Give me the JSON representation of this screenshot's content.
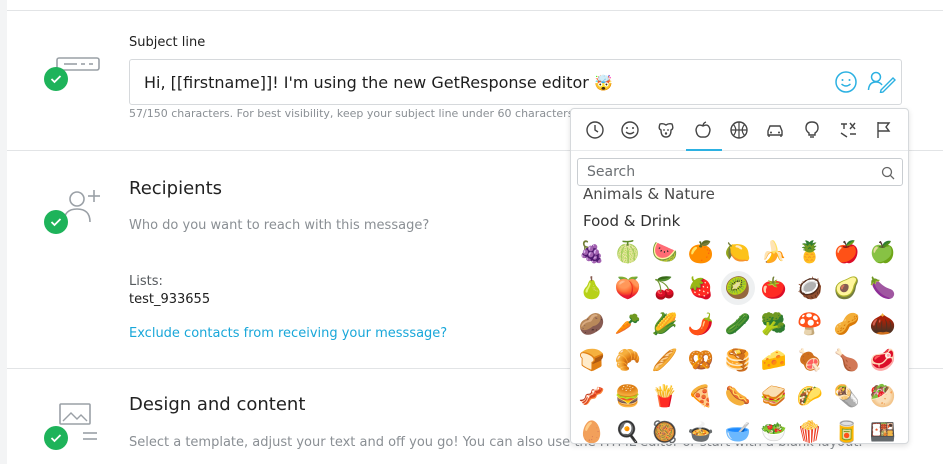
{
  "subject": {
    "label": "Subject line",
    "value": "Hi, [[firstname]]! I'm using the new GetResponse editor",
    "value_emoji": "🤯",
    "hint": "57/150 characters. For best visibility, keep your subject line under 60 characters"
  },
  "recipients": {
    "title": "Recipients",
    "description": "Who do you want to reach with this message?",
    "lists_label": "Lists:",
    "lists_value": "test_933655",
    "exclude_link": "Exclude contacts from receiving your messsage?"
  },
  "design": {
    "title": "Design and content",
    "description": "Select a template, adjust your text and off you go! You can also use the HTML editor or start with a blank layout."
  },
  "emoji_picker": {
    "tabs": [
      "recent-icon",
      "smileys-icon",
      "animals-icon",
      "food-icon",
      "activity-icon",
      "travel-icon",
      "objects-icon",
      "symbols-icon",
      "flags-icon"
    ],
    "active_tab": 3,
    "search_placeholder": "Search",
    "category_previous": "Animals & Nature",
    "category_current": "Food & Drink",
    "emojis": [
      "🍇",
      "🍈",
      "🍉",
      "🍊",
      "🍋",
      "🍌",
      "🍍",
      "🍎",
      "🍏",
      "🍐",
      "🍑",
      "🍒",
      "🍓",
      "🥝",
      "🍅",
      "🥥",
      "🥑",
      "🍆",
      "🥔",
      "🥕",
      "🌽",
      "🌶️",
      "🥒",
      "🥦",
      "🍄",
      "🥜",
      "🌰",
      "🍞",
      "🥐",
      "🥖",
      "🥨",
      "🥞",
      "🧀",
      "🍖",
      "🍗",
      "🥩",
      "🥓",
      "🍔",
      "🍟",
      "🍕",
      "🌭",
      "🥪",
      "🌮",
      "🌯",
      "🥙",
      "🥚",
      "🍳",
      "🥘",
      "🍲",
      "🥣",
      "🥗",
      "🍿",
      "🥫",
      "🍱"
    ],
    "hovered_index": 13
  },
  "colors": {
    "accent": "#2cb1e2",
    "success": "#1eb35a",
    "link": "#19a7d9"
  }
}
